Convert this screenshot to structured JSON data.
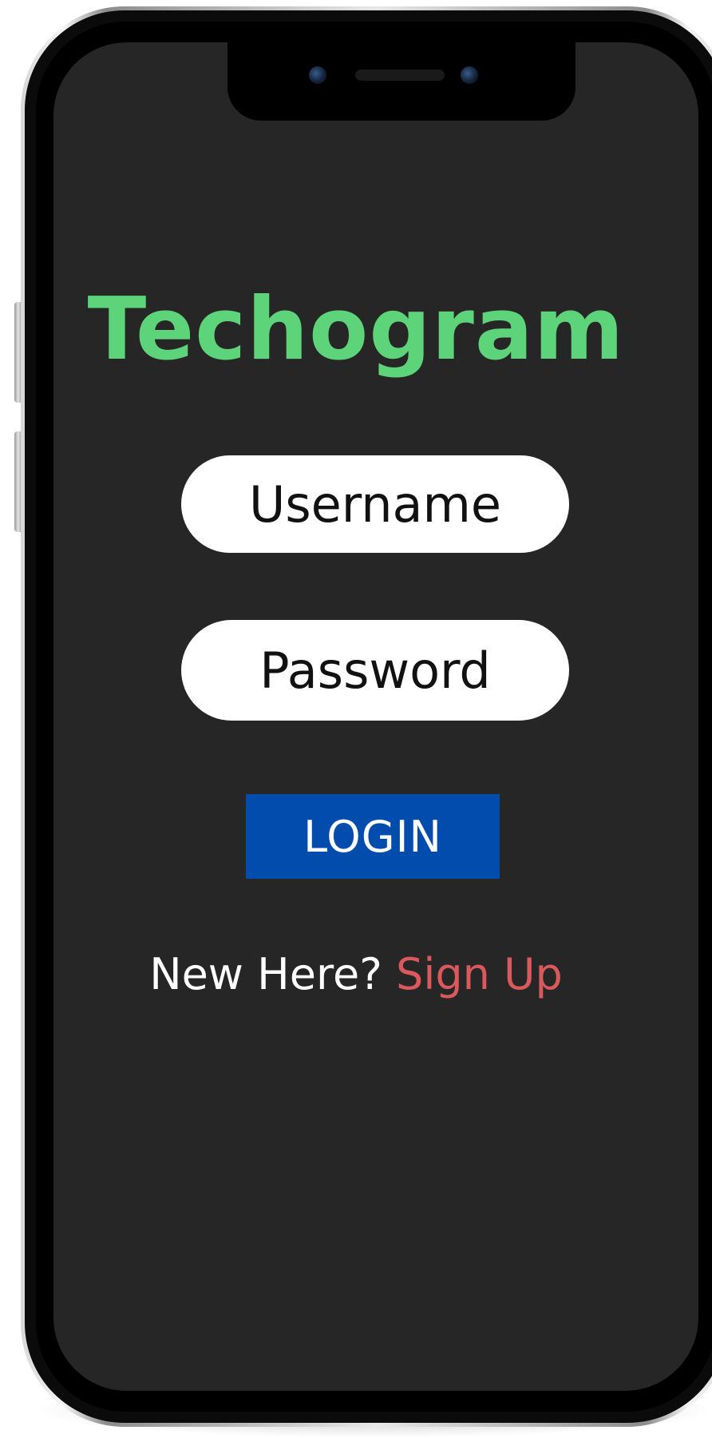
{
  "app": {
    "title": "Techogram"
  },
  "form": {
    "username": {
      "value": "",
      "placeholder": "Username"
    },
    "password": {
      "value": "",
      "placeholder": "Password"
    },
    "login_label": "LOGIN"
  },
  "signup": {
    "prompt": "New Here?",
    "link_label": "Sign Up"
  },
  "colors": {
    "background": "#262626",
    "title": "#5ed47a",
    "login_button": "#014cad",
    "signup_link": "#d9595c",
    "input_background": "#ffffff"
  }
}
